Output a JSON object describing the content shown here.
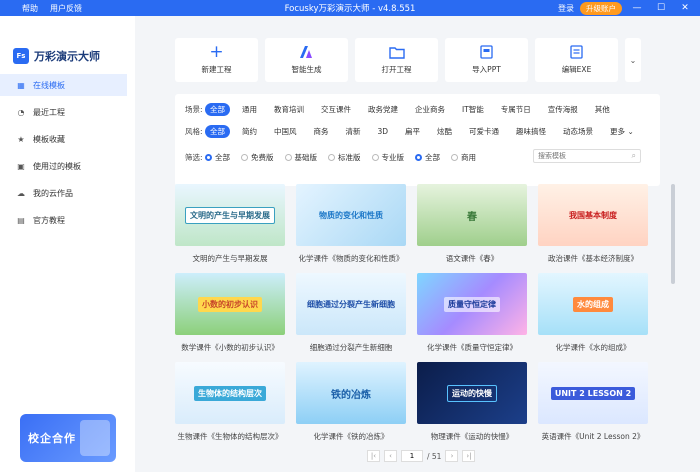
{
  "titlebar": {
    "menu": [
      "帮助",
      "用户反馈"
    ],
    "title": "Focusky万彩演示大师 - v4.8.551",
    "login": "登录",
    "upgrade": "升级账户"
  },
  "app": {
    "logo_badge": "Fs",
    "logo_text": "万彩演示大师"
  },
  "sidebar": {
    "items": [
      {
        "label": "在线模板",
        "icon": "grid-icon",
        "active": true
      },
      {
        "label": "最近工程",
        "icon": "clock-icon"
      },
      {
        "label": "模板收藏",
        "icon": "star-icon"
      },
      {
        "label": "使用过的模板",
        "icon": "history-icon"
      },
      {
        "label": "我的云作品",
        "icon": "cloud-icon"
      },
      {
        "label": "官方教程",
        "icon": "tutorial-icon"
      }
    ],
    "promo": "校企合作"
  },
  "toolbar": [
    {
      "label": "新建工程",
      "icon": "plus-icon"
    },
    {
      "label": "智能生成",
      "icon": "ai-icon"
    },
    {
      "label": "打开工程",
      "icon": "folder-icon"
    },
    {
      "label": "导入PPT",
      "icon": "ppt-icon"
    },
    {
      "label": "编辑EXE",
      "icon": "exe-icon"
    }
  ],
  "filters": {
    "scene": {
      "label": "场景:",
      "options": [
        "全部",
        "通用",
        "教育培训",
        "交互课件",
        "政务党建",
        "企业商务",
        "IT智能",
        "专属节日",
        "宣传海报",
        "其他"
      ]
    },
    "style": {
      "label": "风格:",
      "options": [
        "全部",
        "简约",
        "中国风",
        "商务",
        "清新",
        "3D",
        "扁平",
        "炫酷",
        "可爱卡通",
        "趣味搞怪",
        "动态场景"
      ],
      "more": "更多"
    },
    "filter": {
      "label": "筛选:",
      "version": [
        "全部",
        "免费版",
        "基础版",
        "标准版",
        "专业版"
      ],
      "usage": [
        "全部",
        "商用"
      ],
      "search_placeholder": "搜索模板"
    }
  },
  "templates": [
    {
      "caption": "文明的产生与早期发展",
      "thumb_text": "文明的产生与早期发展"
    },
    {
      "caption": "化学课件《物质的变化和性质》",
      "thumb_text": "物质的变化和性质"
    },
    {
      "caption": "语文课件《春》",
      "thumb_text": "春"
    },
    {
      "caption": "政治课件《基本经济制度》",
      "thumb_text": "我国基本制度"
    },
    {
      "caption": "数学课件《小数的初步认识》",
      "thumb_text": "小数的初步认识"
    },
    {
      "caption": "细胞通过分裂产生新细胞",
      "thumb_text": "细胞通过分裂产生新细胞"
    },
    {
      "caption": "化学课件《质量守恒定律》",
      "thumb_text": "质量守恒定律"
    },
    {
      "caption": "化学课件《水的组成》",
      "thumb_text": "水的组成"
    },
    {
      "caption": "生物课件《生物体的结构层次》",
      "thumb_text": "生物体的结构层次"
    },
    {
      "caption": "化学课件《铁的冶炼》",
      "thumb_text": "铁的冶炼"
    },
    {
      "caption": "物理课件《运动的快慢》",
      "thumb_text": "运动的快慢"
    },
    {
      "caption": "英语课件《Unit 2 Lesson 2》",
      "thumb_text": "UNIT 2 LESSON 2"
    }
  ],
  "pagination": {
    "current": "1",
    "total": "/ 51"
  },
  "colors": {
    "accent": "#2a6bf2",
    "upgrade": "#ff9a1f"
  }
}
